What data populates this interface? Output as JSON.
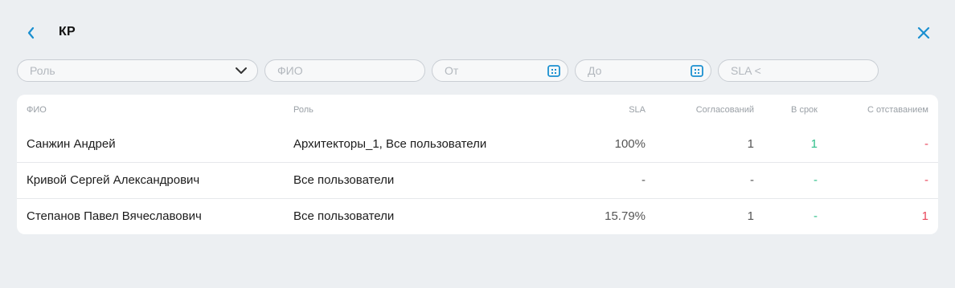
{
  "header": {
    "title": "КР"
  },
  "filters": {
    "role_placeholder": "Роль",
    "fio_placeholder": "ФИО",
    "from_placeholder": "От",
    "to_placeholder": "До",
    "sla_placeholder": "SLA <"
  },
  "colors": {
    "accent": "#1a8fd0",
    "on_time": "#2fbf8a",
    "late": "#e8475b"
  },
  "table": {
    "columns": {
      "fio": "ФИО",
      "role": "Роль",
      "sla": "SLA",
      "approvals": "Согласований",
      "on_time": "В срок",
      "late": "С отставанием"
    },
    "rows": [
      {
        "fio": "Санжин Андрей",
        "role": "Архитекторы_1, Все пользователи",
        "sla": "100%",
        "approvals": "1",
        "on_time": "1",
        "late": "-"
      },
      {
        "fio": "Кривой Сергей Александрович",
        "role": "Все пользователи",
        "sla": "-",
        "approvals": "-",
        "on_time": "-",
        "late": "-"
      },
      {
        "fio": "Степанов Павел Вячеславович",
        "role": "Все пользователи",
        "sla": "15.79%",
        "approvals": "1",
        "on_time": "-",
        "late": "1"
      }
    ]
  }
}
